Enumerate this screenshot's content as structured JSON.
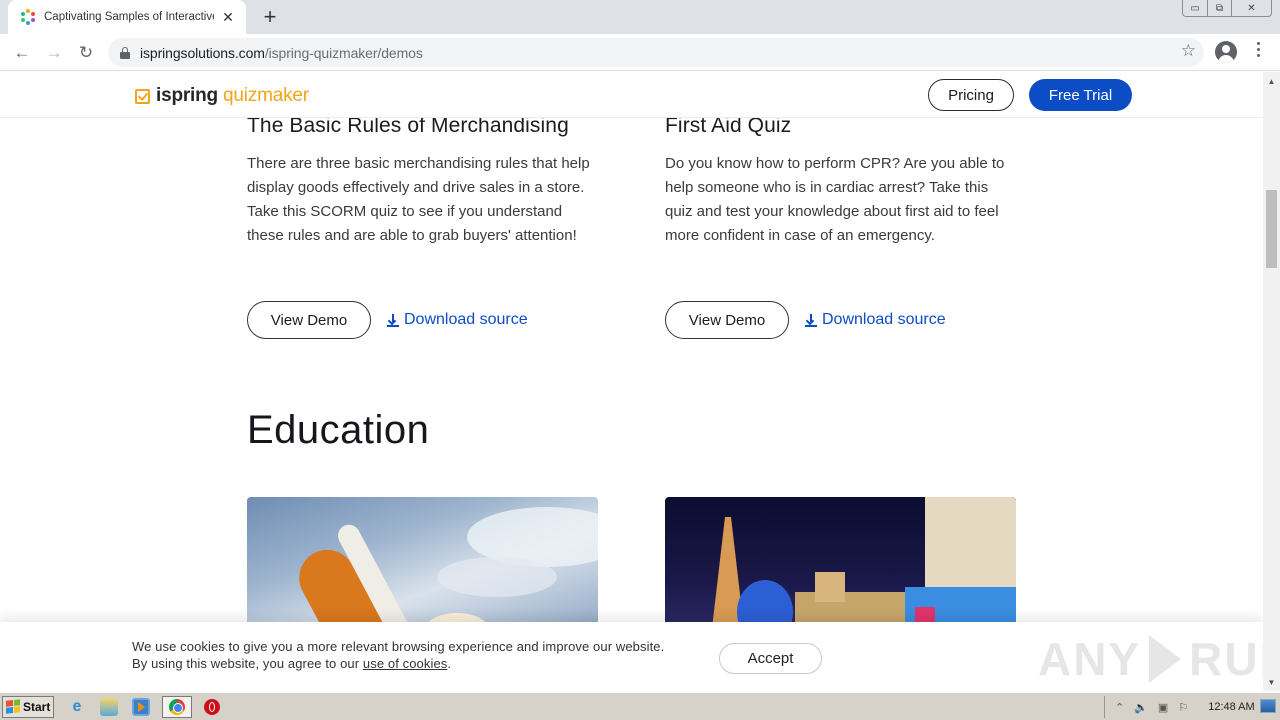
{
  "browser": {
    "tab_title": "Captivating Samples of Interactive Quizzes",
    "tab_close": "✕",
    "new_tab": "+",
    "url_domain": "ispringsolutions.com",
    "url_path": "/ispring-quizmaker/demos",
    "back": "←",
    "forward": "→",
    "reload": "↻",
    "bookmark": "☆",
    "window_controls": {
      "minimize": "▭",
      "restore": "⧉",
      "close": "✕"
    }
  },
  "site": {
    "logo_main": "ispring",
    "logo_accent": " quizmaker",
    "pricing_label": "Pricing",
    "free_trial_label": "Free Trial",
    "accent_color": "#0c4dc5",
    "brand_color": "#f5a31a"
  },
  "cards": [
    {
      "title": "The Basic Rules of Merchandising",
      "description": "There are three basic merchandising rules that help display goods effectively and drive sales in a store. Take this SCORM quiz to see if you understand these rules and are able to grab buyers' attention!",
      "demo_label": "View Demo",
      "download_label": "Download source"
    },
    {
      "title": "First Aid Quiz",
      "description": "Do you know how to perform CPR? Are you able to help someone who is in cardiac arrest? Take this quiz and test your knowledge about first aid to feel more confident in case of an emergency.",
      "demo_label": "View Demo",
      "download_label": "Download source"
    }
  ],
  "education": {
    "heading": "Education",
    "thumbnails": [
      "space-shuttle-launch-image",
      "las-vegas-night-image"
    ]
  },
  "cookie_banner": {
    "line1": "We use cookies to give you a more relevant browsing experience and improve our website.",
    "line2_prefix": "By using this website, you agree to our ",
    "link_text": "use of cookies",
    "line2_suffix": ".",
    "accept_label": "Accept"
  },
  "watermark": {
    "left": "ANY",
    "right": "RUN"
  },
  "taskbar": {
    "start_label": "Start",
    "clock": "12:48 AM"
  }
}
